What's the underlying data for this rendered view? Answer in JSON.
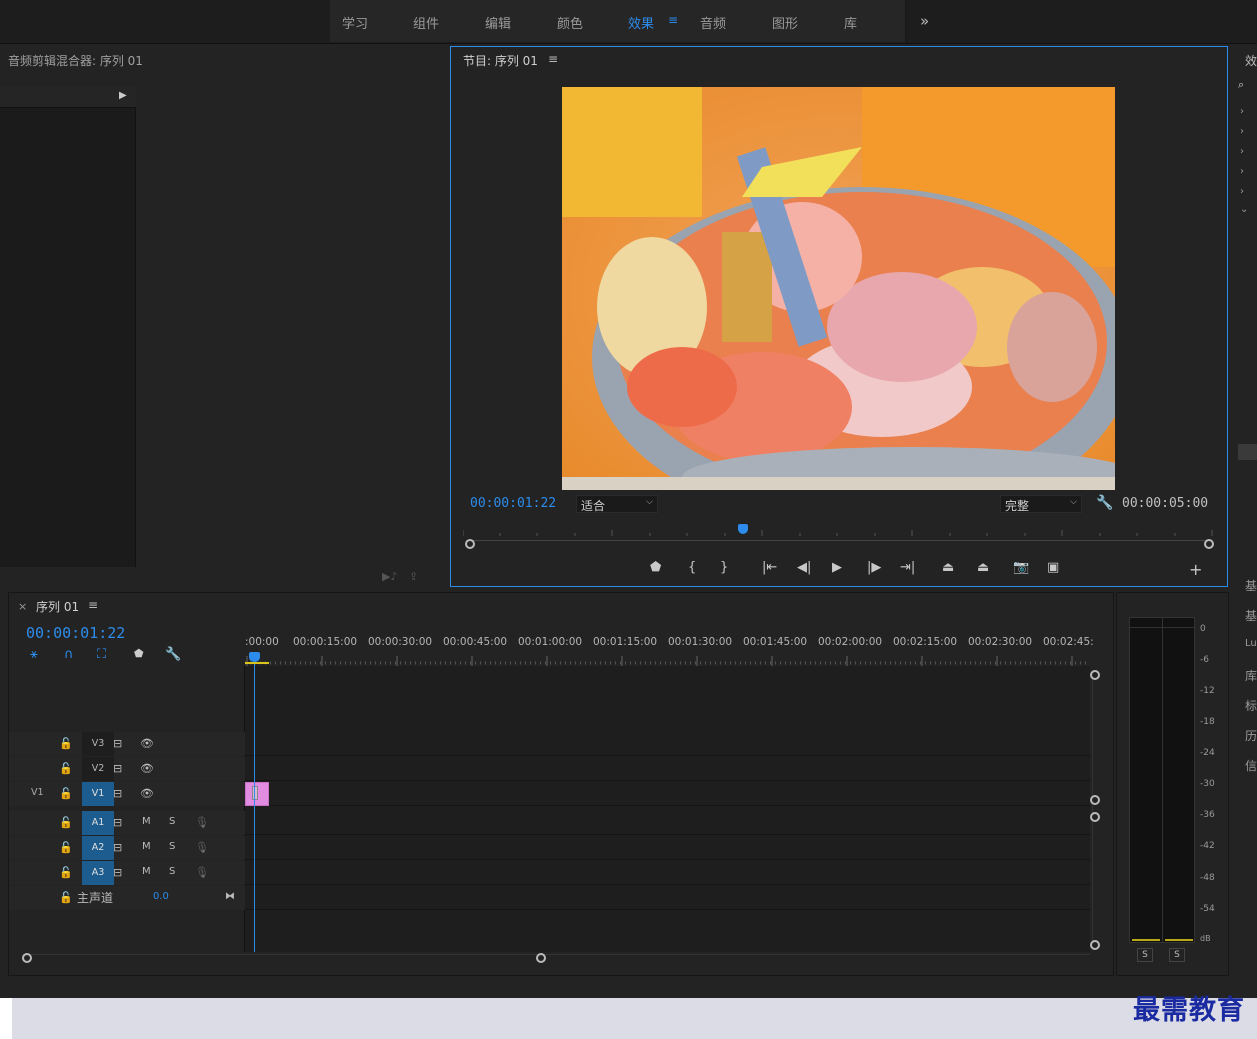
{
  "workspace_tabs": [
    {
      "label": "学习",
      "active": false
    },
    {
      "label": "组件",
      "active": false
    },
    {
      "label": "编辑",
      "active": false
    },
    {
      "label": "颜色",
      "active": false
    },
    {
      "label": "效果",
      "active": true
    },
    {
      "label": "音频",
      "active": false
    },
    {
      "label": "图形",
      "active": false
    },
    {
      "label": "库",
      "active": false
    }
  ],
  "workspace_menu_glyph": "≡",
  "workspace_more_glyph": "»",
  "mixer": {
    "title": "音频剪辑混合器: 序列 01"
  },
  "program": {
    "title": "节目: 序列 01",
    "current_timecode": "00:00:01:22",
    "duration_timecode": "00:00:05:00",
    "fit_select": "适合",
    "quality_select": "完整",
    "menu_glyph": "≡"
  },
  "timeline": {
    "title": "序列 01",
    "timecode": "00:00:01:22",
    "ruler_labels": [
      ":00:00",
      "00:00:15:00",
      "00:00:30:00",
      "00:00:45:00",
      "00:01:00:00",
      "00:01:15:00",
      "00:01:30:00",
      "00:01:45:00",
      "00:02:00:00",
      "00:02:15:00",
      "00:02:30:00",
      "00:02:45:"
    ],
    "tracks": [
      {
        "name": "V3",
        "type": "video",
        "source": "",
        "targeted": false
      },
      {
        "name": "V2",
        "type": "video",
        "source": "",
        "targeted": false
      },
      {
        "name": "V1",
        "type": "video",
        "source": "V1",
        "targeted": true
      },
      {
        "name": "A1",
        "type": "audio",
        "source": "",
        "targeted": true
      },
      {
        "name": "A2",
        "type": "audio",
        "source": "",
        "targeted": true
      },
      {
        "name": "A3",
        "type": "audio",
        "source": "",
        "targeted": true
      }
    ],
    "master": {
      "label": "主声道",
      "value": "0.0"
    },
    "mute_label": "M",
    "solo_label": "S"
  },
  "meter": {
    "scale": [
      "0",
      "-6",
      "-12",
      "-18",
      "-24",
      "-30",
      "-36",
      "-42",
      "-48",
      "-54",
      "dB"
    ],
    "solo_buttons": [
      "S",
      "S"
    ]
  },
  "right_edge_labels": [
    "基",
    "基",
    "Lu",
    "库",
    "标",
    "历",
    "信"
  ],
  "right_top_label": "效",
  "watermark": "最需教育",
  "colors": {
    "accent": "#2d8ceb",
    "clip": "#e28ce1",
    "track_target": "#1c5c8e"
  }
}
